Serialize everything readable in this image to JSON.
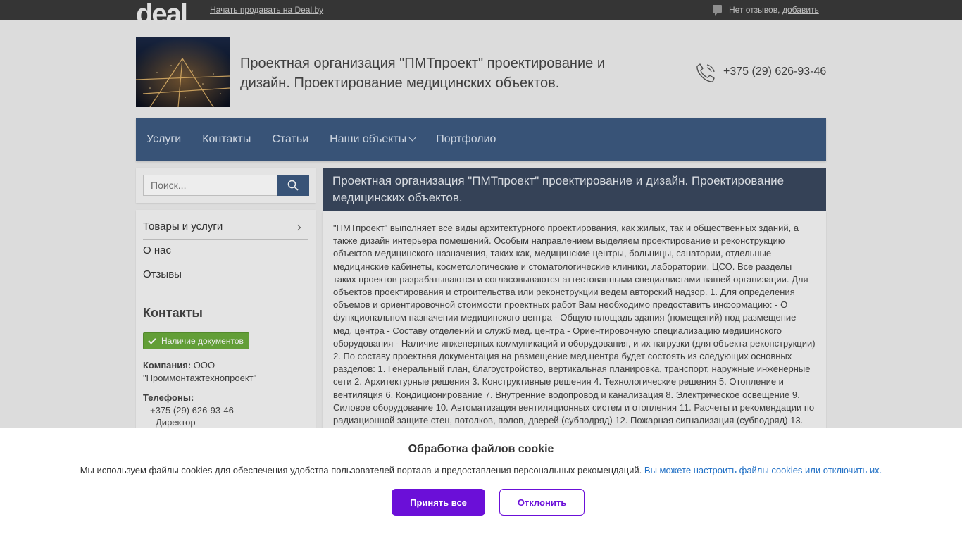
{
  "topbar": {
    "logo": "deal",
    "sell_link": "Начать продавать на Deal.by",
    "reviews_text": "Нет отзывов,",
    "reviews_add": "добавить"
  },
  "header": {
    "title": "Проектная организация \"ПМТпроект\" проектирование и дизайн. Проектирование медицинских объектов.",
    "phone": "+375 (29) 626-93-46"
  },
  "nav": {
    "items": [
      {
        "label": "Услуги"
      },
      {
        "label": "Контакты"
      },
      {
        "label": "Статьи"
      },
      {
        "label": "Наши объекты"
      },
      {
        "label": "Портфолио"
      }
    ]
  },
  "search": {
    "placeholder": "Поиск..."
  },
  "sidebar": {
    "menu": [
      {
        "label": "Товары и услуги"
      },
      {
        "label": "О нас"
      },
      {
        "label": "Отзывы"
      }
    ],
    "contacts_title": "Контакты",
    "docs_badge": "Наличие документов",
    "company_label": "Компания:",
    "company_name": "ООО \"Проммонтажтехнопроект\"",
    "phones_label": "Телефоны:",
    "phone": "+375 (29) 626-93-46",
    "phone_role": "Директор"
  },
  "main": {
    "title": "Проектная организация \"ПМТпроект\" проектирование и дизайн. Проектирование медицинских объектов.",
    "body": "\"ПМТпроект\" выполняет все виды архитектурного проектирования, как жилых, так и общественных зданий, а также дизайн интерьера помещений. Особым направлением выделяем проектирование и реконструкцию объектов медицинского назначения, таких как, медицинские центры, больницы, санатории, отдельные медицинские кабинеты, косметологические и стоматологические клиники, лаборатории, ЦСО. Все разделы таких проектов разрабатываются и согласовываются аттестованными специалистами нашей организации. Для объектов проектирования и строительства или реконструкции ведем авторский надзор. 1. Для определения объемов и ориентировочной стоимости проектных работ Вам необходимо предоставить информацию: - О функциональном назначении медицинского центра - Общую площадь здания (помещений) под размещение мед. центра - Составу отделений и служб мед. центра - Ориентировочную специализацию медицинского оборудования - Наличие инженерных коммуникаций и оборудования, и их нагрузки (для объекта реконструкции) 2. По составу проектная документация на размещение мед.центра будет состоять из следующих основных разделов: 1. Генеральный план, благоустройство, вертикальная планировка, транспорт, наружные инженерные сети 2. Архитектурные решения 3. Конструктивные решения 4. Технологические решения 5. Отопление и вентиляция 6. Кондиционирование 7. Внутренние водопровод и канализация 8. Электрическое освещение 9. Силовое оборудование 10. Автоматизация вентиляционных систем и отопления 11. Расчеты и рекомендации по радиационной защите стен, потолков, полов, дверей (субподряд) 12. Пожарная сигнализация (субподряд) 13."
  },
  "cookie": {
    "title": "Обработка файлов cookie",
    "text": "Мы используем файлы cookies для обеспечения удобства пользователей портала и предоставления персональных рекомендаций.",
    "link": "Вы можете настроить файлы cookies или отключить их.",
    "accept": "Принять все",
    "decline": "Отклонить"
  }
}
